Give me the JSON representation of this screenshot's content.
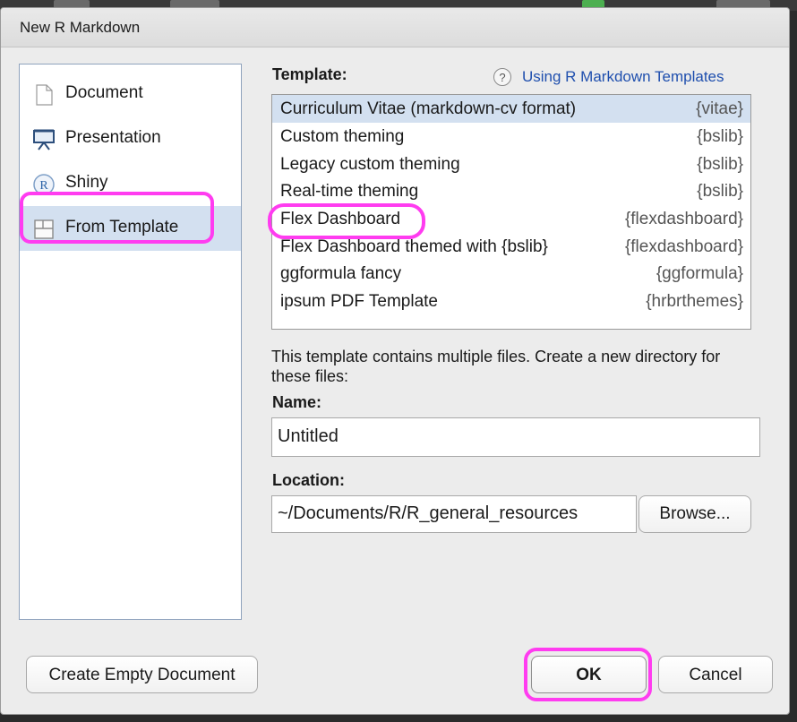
{
  "window": {
    "title": "New R Markdown"
  },
  "types": [
    {
      "label": "Document",
      "icon": "document-icon"
    },
    {
      "label": "Presentation",
      "icon": "presentation-icon"
    },
    {
      "label": "Shiny",
      "icon": "shiny-icon"
    },
    {
      "label": "From Template",
      "icon": "template-icon",
      "selected": true
    }
  ],
  "template": {
    "label": "Template:",
    "help_icon": "?",
    "help_link": "Using R Markdown Templates",
    "items": [
      {
        "name": "Curriculum Vitae (markdown-cv format)",
        "pkg": "{vitae}",
        "selected": true
      },
      {
        "name": "Custom theming",
        "pkg": "{bslib}"
      },
      {
        "name": "Legacy custom theming",
        "pkg": "{bslib}"
      },
      {
        "name": "Real-time theming",
        "pkg": "{bslib}"
      },
      {
        "name": "Flex Dashboard",
        "pkg": "{flexdashboard}"
      },
      {
        "name": "Flex Dashboard themed with {bslib}",
        "pkg": "{flexdashboard}"
      },
      {
        "name": "ggformula fancy",
        "pkg": "{ggformula}"
      },
      {
        "name": "ipsum PDF Template",
        "pkg": "{hrbrthemes}"
      }
    ]
  },
  "description": "This template contains multiple files. Create a new directory for these files:",
  "name_field": {
    "label": "Name:",
    "value": "Untitled"
  },
  "location_field": {
    "label": "Location:",
    "value": "~/Documents/R/R_general_resources",
    "browse_label": "Browse..."
  },
  "buttons": {
    "create_empty": "Create Empty Document",
    "ok": "OK",
    "cancel": "Cancel"
  },
  "colors": {
    "highlight_ring": "#ff3cf0",
    "selection": "#d3e0f0",
    "link": "#1f4fae"
  }
}
